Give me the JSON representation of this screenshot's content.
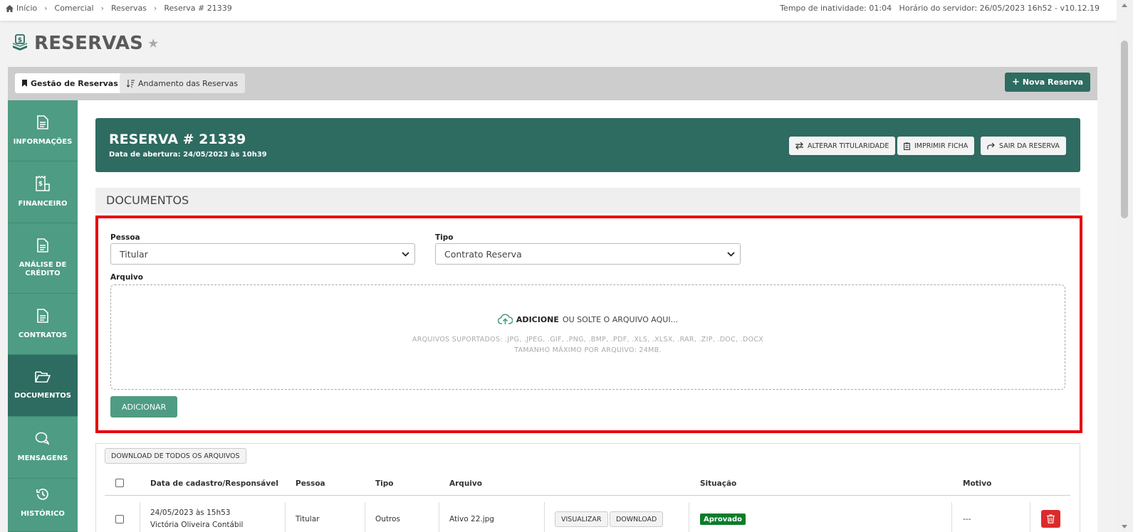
{
  "breadcrumb": {
    "items": [
      "Início",
      "Comercial",
      "Reservas",
      "Reserva # 21339"
    ],
    "info": "Tempo de inatividade: 01:04   Horário do servidor: 26/05/2023 16h52 - v10.12.19"
  },
  "page": {
    "title": "RESERVAS"
  },
  "tabs": {
    "active": "Gestão de Reservas",
    "inactive": "Andamento das Reservas",
    "new_button": "Nova Reserva"
  },
  "sidebar": {
    "items": [
      {
        "label": "INFORMAÇÕES",
        "icon": "document-icon"
      },
      {
        "label": "FINANCEIRO",
        "icon": "receipt-dollar-icon"
      },
      {
        "label": "ANÁLISE DE CRÉDITO",
        "icon": "document-icon"
      },
      {
        "label": "CONTRATOS",
        "icon": "document-icon"
      },
      {
        "label": "DOCUMENTOS",
        "icon": "folder-open-icon",
        "active": true
      },
      {
        "label": "MENSAGENS",
        "icon": "chat-icon"
      },
      {
        "label": "HISTÓRICO",
        "icon": "history-icon"
      }
    ]
  },
  "reservation": {
    "title": "RESERVA # 21339",
    "opened": "Data de abertura: 24/05/2023 às 10h39",
    "buttons": {
      "transfer": "ALTERAR TITULARIDADE",
      "print": "IMPRIMIR FICHA",
      "exit": "SAIR DA RESERVA"
    }
  },
  "documents": {
    "section_title": "DOCUMENTOS",
    "form": {
      "pessoa_label": "Pessoa",
      "pessoa_value": "Titular",
      "tipo_label": "Tipo",
      "tipo_value": "Contrato Reserva",
      "arquivo_label": "Arquivo",
      "drop_bold": "ADICIONE",
      "drop_rest": "OU SOLTE O ARQUIVO AQUI...",
      "supported": "ARQUIVOS SUPORTADOS: .JPG, .JPEG, .GIF, .PNG, .BMP, .PDF, .XLS, .XLSX, .RAR, .ZIP, .DOC, .DOCX",
      "max_size": "TAMANHO MÁXIMO POR ARQUIVO: 24MB.",
      "add_button": "ADICIONAR"
    },
    "download_all": "DOWNLOAD DE TODOS OS ARQUIVOS",
    "table": {
      "headers": [
        "Data de cadastro/Responsável",
        "Pessoa",
        "Tipo",
        "Arquivo",
        "Situação",
        "Motivo"
      ],
      "rows": [
        {
          "date": "24/05/2023 às 15h53",
          "responsible": "Victória Oliveira Contábil",
          "pessoa": "Titular",
          "tipo": "Outros",
          "arquivo": "Ativo 22.jpg",
          "view": "VISUALIZAR",
          "download": "DOWNLOAD",
          "situacao": "Aprovado",
          "motivo": "---"
        }
      ]
    }
  },
  "colors": {
    "primary_dark": "#2e6b61",
    "primary": "#4e9c83",
    "highlight": "#e8000b",
    "approved": "#087d2c",
    "danger": "#dc2b2b"
  }
}
